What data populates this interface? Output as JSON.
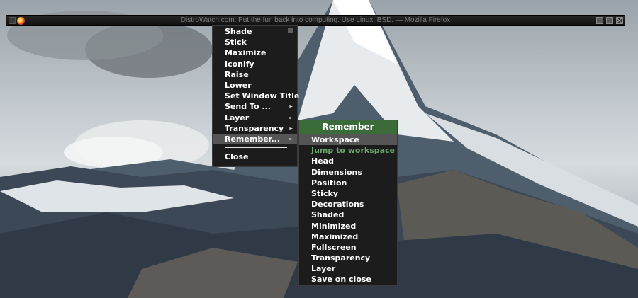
{
  "window": {
    "title": "DistroWatch.com: Put the fun back into computing. Use Linux, BSD. — Mozilla Firefox"
  },
  "window_menu": {
    "items": [
      {
        "label": "Shade"
      },
      {
        "label": "Stick"
      },
      {
        "label": "Maximize"
      },
      {
        "label": "Iconify"
      },
      {
        "label": "Raise"
      },
      {
        "label": "Lower"
      },
      {
        "label": "Set Window Title"
      },
      {
        "label": "Send To ..."
      },
      {
        "label": "Layer"
      },
      {
        "label": "Transparency"
      },
      {
        "label": "Remember..."
      }
    ],
    "close_label": "Close"
  },
  "remember_menu": {
    "title": "Remember",
    "items": [
      {
        "label": "Workspace"
      },
      {
        "label": "Jump to workspace"
      },
      {
        "label": "Head"
      },
      {
        "label": "Dimensions"
      },
      {
        "label": "Position"
      },
      {
        "label": "Sticky"
      },
      {
        "label": "Decorations"
      },
      {
        "label": "Shaded"
      },
      {
        "label": "Minimized"
      },
      {
        "label": "Maximized"
      },
      {
        "label": "Fullscreen"
      },
      {
        "label": "Transparency"
      },
      {
        "label": "Layer"
      },
      {
        "label": "Save on close"
      }
    ]
  },
  "colors": {
    "menu_bg": "#1c1c1c",
    "highlight": "#555555",
    "submenu_title_bg": "#3c6b3a",
    "disabled_text": "#6aa56a"
  },
  "icons": [
    "window-menu-icon",
    "firefox-icon",
    "minimize-icon",
    "maximize-icon",
    "close-icon",
    "submenu-arrow-icon",
    "checkbox-icon"
  ]
}
